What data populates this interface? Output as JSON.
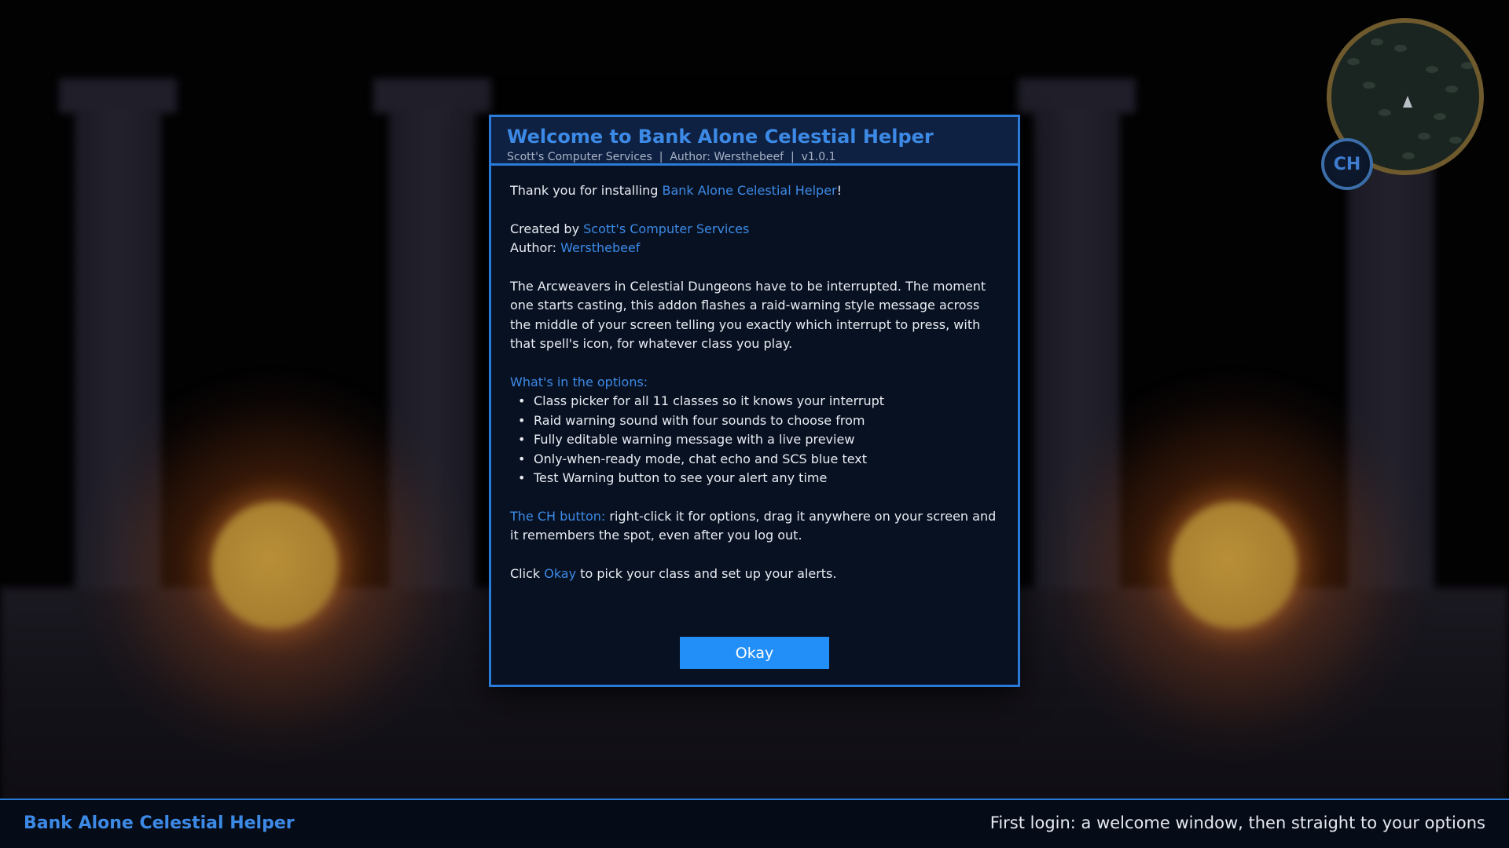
{
  "dialog": {
    "title": "Welcome to Bank Alone Celestial Helper",
    "subtitle": "Scott's Computer Services  |  Author: Wersthebeef  |  v1.0.1",
    "intro_prefix": "Thank you for installing ",
    "intro_name": "Bank Alone Celestial Helper",
    "intro_suffix": "!",
    "created_by_label": "Created by ",
    "created_by_value": "Scott's Computer Services",
    "author_label": "Author: ",
    "author_value": "Wersthebeef",
    "description": "The Arcweavers in Celestial Dungeons have to be interrupted. The moment one starts casting, this addon flashes a raid-warning style message across the middle of your screen telling you exactly which interrupt to press, with that spell's icon, for whatever class you play.",
    "options_heading": "What's in the options:",
    "options": [
      "Class picker for all 11 classes so it knows your interrupt",
      "Raid warning sound with four sounds to choose from",
      "Fully editable warning message with a live preview",
      "Only-when-ready mode, chat echo and SCS blue text",
      "Test Warning button to see your alert any time"
    ],
    "ch_heading": "The CH button:",
    "ch_text": " right-click it for options, drag it anywhere on your screen and it remembers the spot, even after you log out.",
    "click_prefix": "Click ",
    "click_okay": "Okay",
    "click_suffix": " to pick your class and set up your alerts.",
    "okay_label": "Okay"
  },
  "minimap": {
    "ch_label": "CH"
  },
  "footer": {
    "left": "Bank Alone Celestial Helper",
    "right": "First login: a welcome window, then straight to your options"
  },
  "colors": {
    "accent": "#2a7bd9",
    "link": "#3c8ae6",
    "button": "#228ef7"
  }
}
